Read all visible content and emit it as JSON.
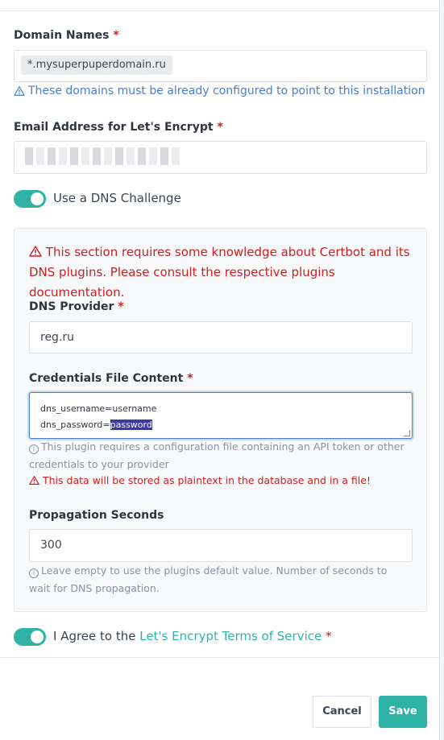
{
  "domain_names": {
    "label": "Domain Names",
    "required_mark": "*",
    "tag": "*.mysuperpuperdomain.ru",
    "hint": "These domains must be already configured to point to this installation"
  },
  "email": {
    "label": "Email Address for Let's Encrypt",
    "required_mark": "*"
  },
  "dns_challenge": {
    "label": "Use a DNS Challenge",
    "enabled": true
  },
  "dns_section": {
    "warning": "This section requires some knowledge about Certbot and its DNS plugins. Please consult the respective plugins documentation.",
    "provider_label": "DNS Provider",
    "provider_value": "reg.ru",
    "credentials_label": "Credentials File Content",
    "credentials_line1": "dns_username=username",
    "credentials_line2_prefix": "dns_password=",
    "credentials_line2_selected": "password",
    "credentials_hint": "This plugin requires a configuration file containing an API token or other credentials to your provider",
    "credentials_warning": "This data will be stored as plaintext in the database and in a file!",
    "propagation_label": "Propagation Seconds",
    "propagation_value": "300",
    "propagation_hint": "Leave empty to use the plugins default value. Number of seconds to wait for DNS propagation."
  },
  "agree": {
    "prefix": "I Agree to the",
    "link": "Let's Encrypt Terms of Service",
    "required_mark": "*",
    "enabled": true
  },
  "footer": {
    "cancel": "Cancel",
    "save": "Save"
  },
  "colors": {
    "accent": "#2fb3a7",
    "danger": "#cd201f",
    "info": "#467fcf"
  }
}
